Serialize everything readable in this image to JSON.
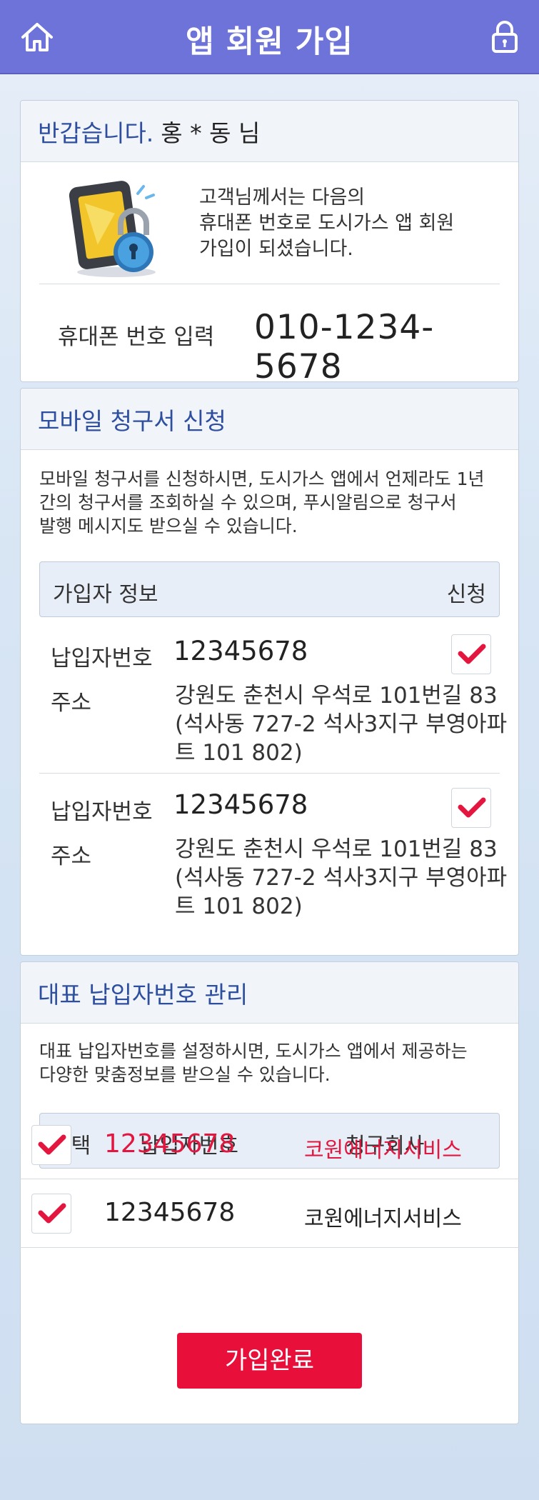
{
  "header": {
    "title": "앱 회원 가입",
    "home_icon": "home-icon",
    "lock_icon": "lock-icon"
  },
  "greeting": {
    "title": "반갑습니다.",
    "name": "홍 * 동 님"
  },
  "intro": {
    "lines": [
      "고객님께서는 다음의",
      "휴대폰 번호로 도시가스 앱 회원",
      "가입이 되셨습니다."
    ],
    "phone_label": "휴대폰 번호 입력",
    "phone_value": "010-1234-5678"
  },
  "mobile_bill": {
    "title": "모바일 청구서 신청",
    "description_lines": [
      "모바일 청구서를 신청하시면, 도시가스 앱에서 언제라도 1년",
      "간의 청구서를 조회하실 수 있으며,  푸시알림으로 청구서",
      "발행 메시지도 받으실 수 있습니다."
    ],
    "col_info": "가입자 정보",
    "col_apply": "신청",
    "entries": [
      {
        "payer_label": "납입자번호",
        "payer_number": "12345678",
        "address_label": "주소",
        "address_lines": [
          "강원도 춘천시 우석로 101번길 83",
          "(석사동  727-2 석사3지구 부영아파",
          "트 101 802)"
        ],
        "checked": true
      },
      {
        "payer_label": "납입자번호",
        "payer_number": "12345678",
        "address_label": "주소",
        "address_lines": [
          "강원도 춘천시 우석로 101번길 83",
          "(석사동  727-2 석사3지구 부영아파",
          "트 101 802)"
        ],
        "checked": true
      }
    ]
  },
  "rep_payer": {
    "title": "대표 납입자번호 관리",
    "description_lines": [
      "대표 납입자번호를 설정하시면, 도시가스 앱에서 제공하는",
      "다양한 맞춤정보를 받으실 수 있습니다."
    ],
    "col_select": "선택",
    "col_payer": "납입자번호",
    "col_company": "청구회사",
    "rows": [
      {
        "payer_number": "12345678",
        "company": "코원에너지서비스",
        "checked": true,
        "highlight": true
      },
      {
        "payer_number": "12345678",
        "company": "코원에너지서비스",
        "checked": true,
        "highlight": false
      }
    ]
  },
  "submit_label": "가입완료",
  "colors": {
    "header": "#6d73d9",
    "accent_red": "#e2163f",
    "title_blue": "#2e4fa0"
  }
}
